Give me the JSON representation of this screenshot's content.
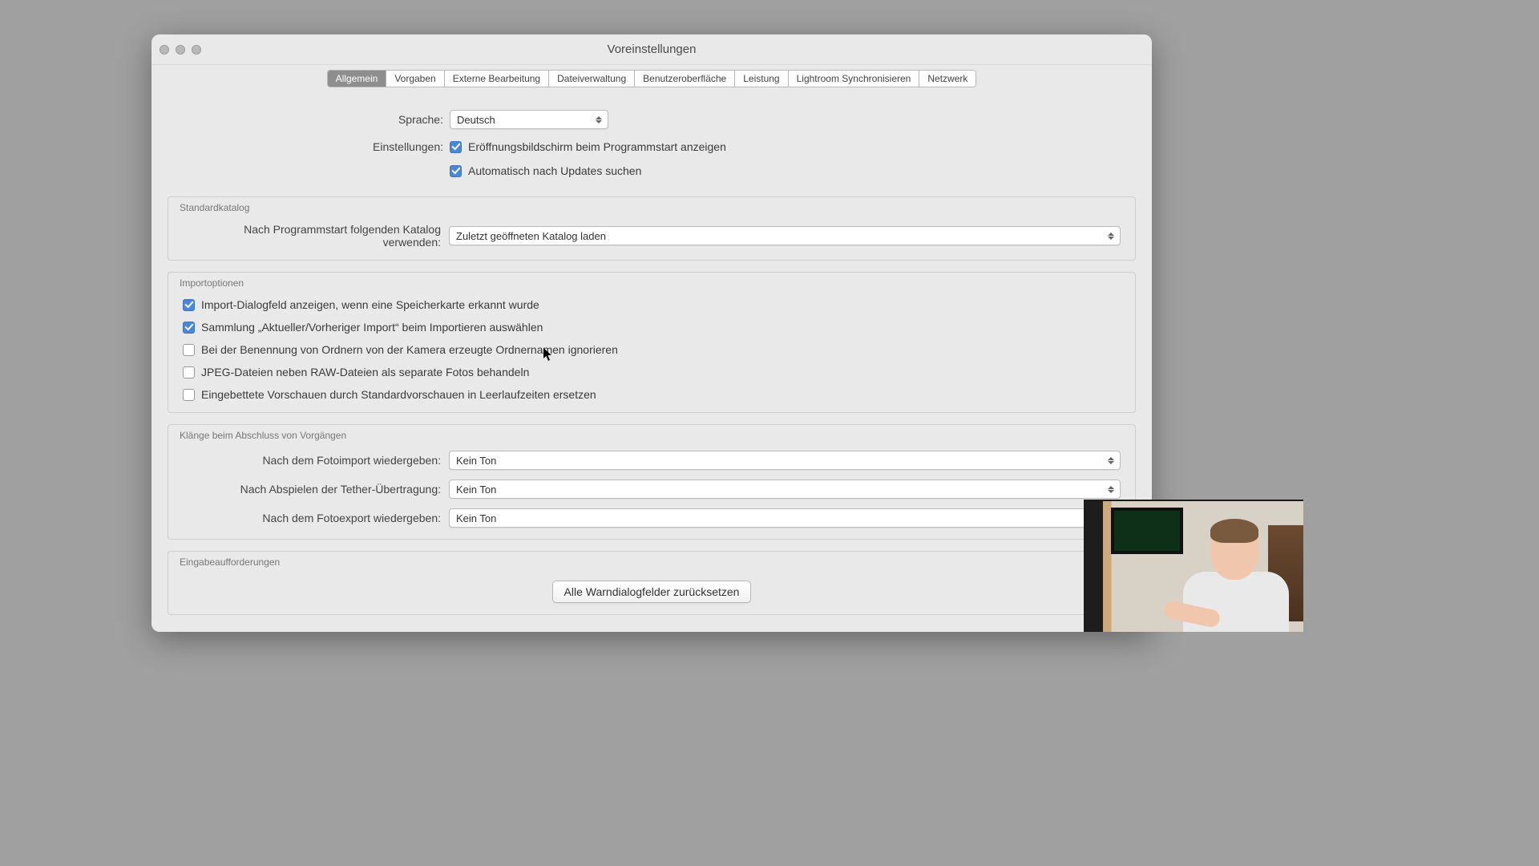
{
  "window": {
    "title": "Voreinstellungen"
  },
  "tabs": [
    {
      "label": "Allgemein",
      "active": true
    },
    {
      "label": "Vorgaben"
    },
    {
      "label": "Externe Bearbeitung"
    },
    {
      "label": "Dateiverwaltung"
    },
    {
      "label": "Benutzeroberfläche"
    },
    {
      "label": "Leistung"
    },
    {
      "label": "Lightroom Synchronisieren"
    },
    {
      "label": "Netzwerk"
    }
  ],
  "general": {
    "language_label": "Sprache:",
    "language_value": "Deutsch",
    "settings_label": "Einstellungen:",
    "show_splash": "Eröffnungsbildschirm beim Programmstart anzeigen",
    "auto_update": "Automatisch nach Updates suchen"
  },
  "catalog": {
    "group_title": "Standardkatalog",
    "label": "Nach Programmstart folgenden Katalog verwenden:",
    "value": "Zuletzt geöffneten Katalog laden"
  },
  "import": {
    "group_title": "Importoptionen",
    "opt1": "Import-Dialogfeld anzeigen, wenn eine Speicherkarte erkannt wurde",
    "opt2": "Sammlung „Aktueller/Vorheriger Import“ beim Importieren auswählen",
    "opt3": "Bei der Benennung von Ordnern von der Kamera erzeugte Ordnernamen ignorieren",
    "opt4": "JPEG-Dateien neben RAW-Dateien als separate Fotos behandeln",
    "opt5": "Eingebettete Vorschauen durch Standardvorschauen in Leerlaufzeiten ersetzen"
  },
  "sounds": {
    "group_title": "Klänge beim Abschluss von Vorgängen",
    "after_import_label": "Nach dem Fotoimport wiedergeben:",
    "after_import_value": "Kein Ton",
    "after_tether_label": "Nach Abspielen der Tether-Übertragung:",
    "after_tether_value": "Kein Ton",
    "after_export_label": "Nach dem Fotoexport wiedergeben:",
    "after_export_value": "Kein Ton"
  },
  "prompts": {
    "group_title": "Eingabeaufforderungen",
    "reset_button": "Alle Warndialogfelder zurücksetzen"
  }
}
